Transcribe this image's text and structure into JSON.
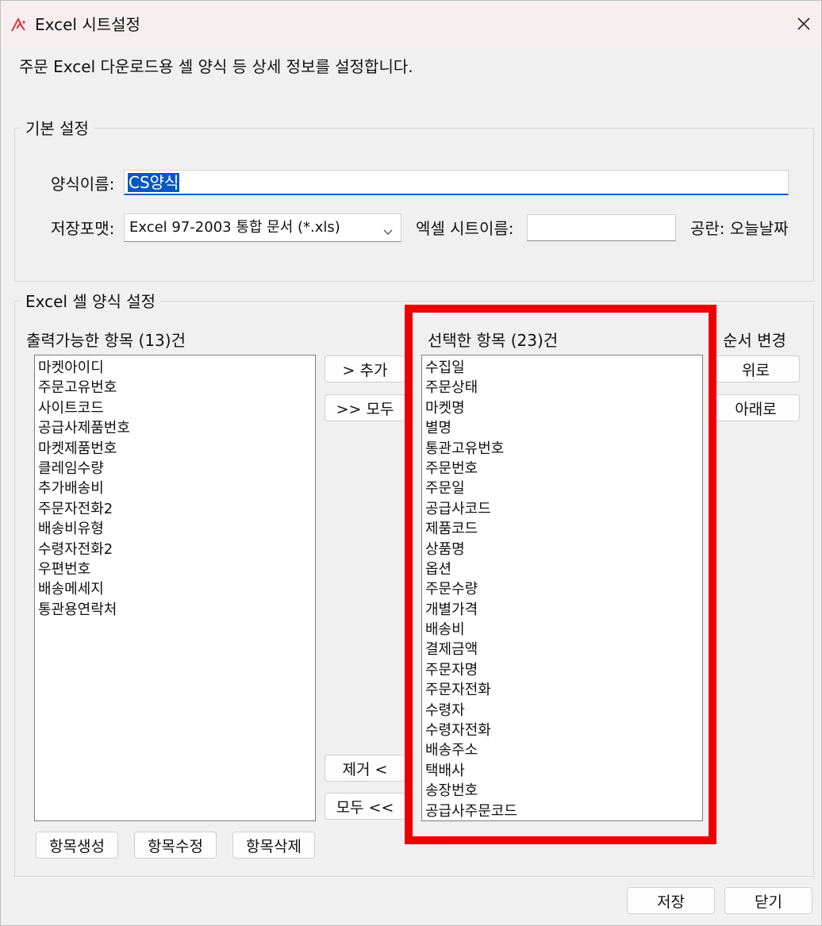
{
  "window": {
    "title": "Excel 시트설정",
    "description": "주문 Excel 다운로드용 셀 양식 등 상세 정보를 설정합니다."
  },
  "basic_settings": {
    "legend": "기본 설정",
    "form_name_label": "양식이름:",
    "form_name_value": "CS양식",
    "save_format_label": "저장포맷:",
    "save_format_value": "Excel 97-2003 통합 문서 (*.xls)",
    "sheet_name_label": "엑셀 시트이름:",
    "sheet_name_value": "",
    "sheet_name_hint": "공란: 오늘날짜"
  },
  "cell_settings": {
    "legend": "Excel 셀 양식 설정",
    "available_header": "출력가능한 항목 (13)건",
    "available_items": [
      "마켓아이디",
      "주문고유번호",
      "사이트코드",
      "공급사제품번호",
      "마켓제품번호",
      "클레임수량",
      "추가배송비",
      "주문자전화2",
      "배송비유형",
      "수령자전화2",
      "우편번호",
      "배송메세지",
      "통관용연락처"
    ],
    "selected_header": "선택한 항목 (23)건",
    "selected_items": [
      "수집일",
      "주문상태",
      "마켓명",
      "별명",
      "통관고유번호",
      "주문번호",
      "주문일",
      "공급사코드",
      "제품코드",
      "상품명",
      "옵션",
      "주문수량",
      "개별가격",
      "배송비",
      "결제금액",
      "주문자명",
      "주문자전화",
      "수령자",
      "수령자전화",
      "배송주소",
      "택배사",
      "송장번호",
      "공급사주문코드"
    ],
    "order_header": "순서 변경",
    "add_button": "> 추가",
    "add_all_button": ">> 모두",
    "remove_button": "제거 <",
    "remove_all_button": "모두 <<",
    "up_button": "위로",
    "down_button": "아래로",
    "create_item_button": "항목생성",
    "edit_item_button": "항목수정",
    "delete_item_button": "항목삭제"
  },
  "footer": {
    "save_button": "저장",
    "close_button": "닫기"
  },
  "colors": {
    "highlight": "#ee0000",
    "selection": "#0a57c2",
    "input_focus_underline": "#1b5fb4"
  },
  "icons": {
    "app": "app-logo-icon",
    "close": "close-icon",
    "dropdown": "chevron-down-icon"
  }
}
